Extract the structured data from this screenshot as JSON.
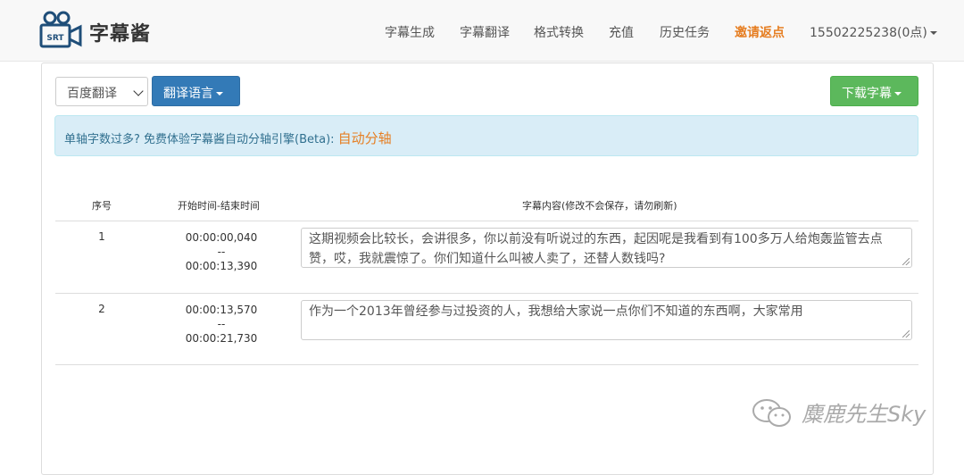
{
  "brand": {
    "name": "字幕酱",
    "logo_text": "SRT"
  },
  "nav": {
    "items": [
      {
        "label": "字幕生成"
      },
      {
        "label": "字幕翻译"
      },
      {
        "label": "格式转换"
      },
      {
        "label": "充值"
      },
      {
        "label": "历史任务"
      },
      {
        "label": "邀请返点",
        "highlight": true
      }
    ],
    "account": "15502225238(0点)"
  },
  "toolbar": {
    "engine_select": "百度翻译",
    "translate_lang_label": "翻译语言",
    "download_label": "下载字幕"
  },
  "alert": {
    "text": "单轴字数过多? 免费体验字幕酱自动分轴引擎(Beta): ",
    "link": "自动分轴"
  },
  "table": {
    "headers": [
      "序号",
      "开始时间-结束时间",
      "字幕内容(修改不会保存，请勿刷新)"
    ],
    "rows": [
      {
        "index": "1",
        "start": "00:00:00,040",
        "sep": "--",
        "end": "00:00:13,390",
        "content": "这期视频会比较长，会讲很多，你以前没有听说过的东西，起因呢是我看到有100多万人给炮轰监管去点赞，哎，我就震惊了。你们知道什么叫被人卖了，还替人数钱吗?"
      },
      {
        "index": "2",
        "start": "00:00:13,570",
        "sep": "--",
        "end": "00:00:21,730",
        "content": "作为一个2013年曾经参与过投资的人，我想给大家说一点你们不知道的东西啊，大家常用"
      }
    ]
  },
  "watermark": "麋鹿先生Sky",
  "colors": {
    "primary": "#337ab7",
    "success": "#5cb85c",
    "info_bg": "#d9edf7",
    "accent": "#e67e22"
  }
}
